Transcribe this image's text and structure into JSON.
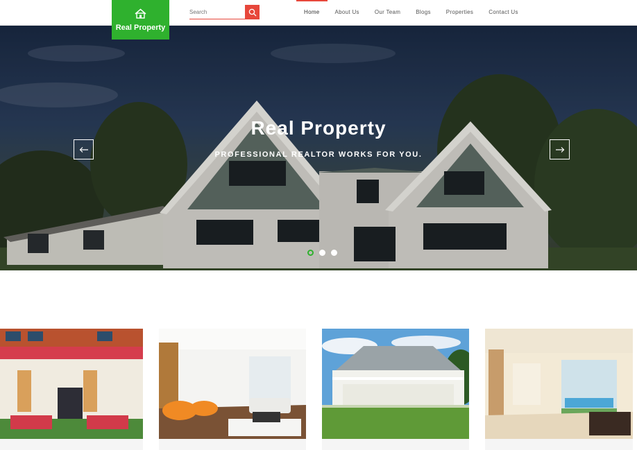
{
  "logo": {
    "icon": "house-icon",
    "brand": "Real Property"
  },
  "search": {
    "placeholder": "Search",
    "icon": "search-icon"
  },
  "nav": {
    "items": [
      {
        "label": "Home",
        "active": true
      },
      {
        "label": "About Us"
      },
      {
        "label": "Our Team"
      },
      {
        "label": "Blogs"
      },
      {
        "label": "Properties"
      },
      {
        "label": "Contact Us"
      }
    ]
  },
  "hero": {
    "title": "Real Property",
    "subtitle": "PROFESSIONAL REALTOR WORKS FOR YOU.",
    "prev_icon": "arrow-left-icon",
    "next_icon": "arrow-right-icon",
    "slides_total": 3,
    "slide_active": 1
  },
  "colors": {
    "accent": "#2fb12e",
    "highlight": "#e7473b"
  },
  "cards": [
    {
      "alt": "house-with-flowers"
    },
    {
      "alt": "living-room"
    },
    {
      "alt": "white-farmhouse"
    },
    {
      "alt": "interior-pool-view"
    }
  ]
}
